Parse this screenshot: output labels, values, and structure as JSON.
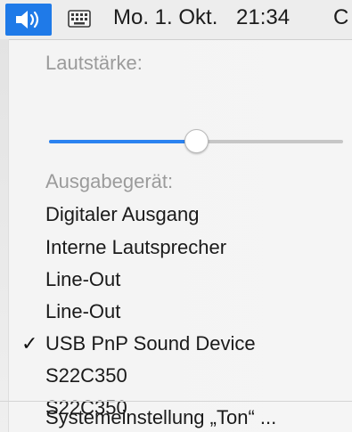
{
  "menubar": {
    "date": "Mo. 1. Okt.",
    "time": "21:34",
    "trailing": "C",
    "active_icon": "volume-icon",
    "keyboard_icon": "keyboard-icon",
    "accent_color": "#1f7ae8"
  },
  "menu": {
    "volume_label": "Lautstärke:",
    "volume_level": 0.5,
    "output_label": "Ausgabegerät:",
    "devices": [
      {
        "label": "Digitaler Ausgang",
        "selected": false
      },
      {
        "label": "Interne Lautsprecher",
        "selected": false
      },
      {
        "label": "Line-Out",
        "selected": false
      },
      {
        "label": "Line-Out",
        "selected": false
      },
      {
        "label": "USB PnP Sound Device",
        "selected": true
      },
      {
        "label": "S22C350",
        "selected": false
      },
      {
        "label": "S22C350",
        "selected": false
      }
    ],
    "check_mark": "✓",
    "settings_label": "Systemeinstellung „Ton“ ..."
  }
}
